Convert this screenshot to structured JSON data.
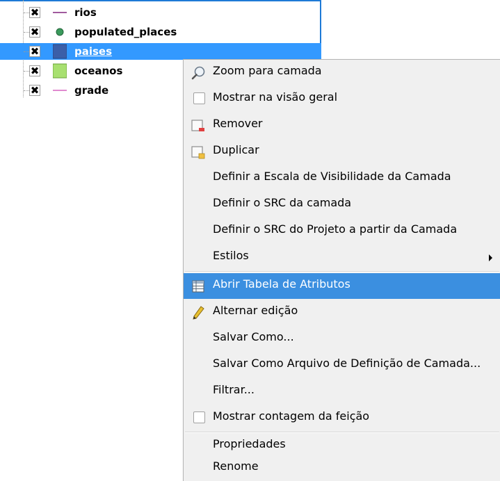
{
  "layers": [
    {
      "name": "rios",
      "checked_symbol": "✖",
      "symbol": "purple-line",
      "selected": false
    },
    {
      "name": "populated_places",
      "checked_symbol": "✖",
      "symbol": "green-dot",
      "selected": false
    },
    {
      "name": "paises",
      "checked_symbol": "✖",
      "symbol": "blue-fill",
      "selected": true
    },
    {
      "name": "oceanos",
      "checked_symbol": "✖",
      "symbol": "light-green-fill",
      "selected": false
    },
    {
      "name": "grade",
      "checked_symbol": "✖",
      "symbol": "pink-line",
      "selected": false
    }
  ],
  "context_menu": {
    "items": [
      {
        "label": "Zoom para camada",
        "icon": "zoom-icon"
      },
      {
        "label": "Mostrar na visão geral",
        "icon": "checkbox-icon"
      },
      {
        "label": "Remover",
        "icon": "remove-layer-icon"
      },
      {
        "label": "Duplicar",
        "icon": "duplicate-layer-icon"
      },
      {
        "label": "Definir a Escala de Visibilidade da Camada"
      },
      {
        "label": "Definir o SRC da camada"
      },
      {
        "label": "Definir o SRC do Projeto a partir da Camada"
      },
      {
        "label": "Estilos",
        "submenu": true
      },
      {
        "label": "Abrir Tabela de Atributos",
        "icon": "table-icon",
        "highlighted": true
      },
      {
        "label": "Alternar edição",
        "icon": "pencil-icon"
      },
      {
        "label": "Salvar Como..."
      },
      {
        "label": "Salvar Como Arquivo de Definição de Camada..."
      },
      {
        "label": "Filtrar..."
      },
      {
        "label": "Mostrar contagem da feição",
        "icon": "checkbox-icon"
      },
      {
        "label": "Propriedades"
      },
      {
        "label": "Renome"
      }
    ]
  },
  "colors": {
    "selection": "#3399ff",
    "menu_highlight": "#3b8fe0",
    "menu_background": "#f0f0f0",
    "rios_line": "#a05a9e",
    "populated_places_dot": "#3a9a5c",
    "paises_fill": "#3b5fa8",
    "oceanos_fill": "#a8e070",
    "grade_line": "#e08ad0"
  }
}
